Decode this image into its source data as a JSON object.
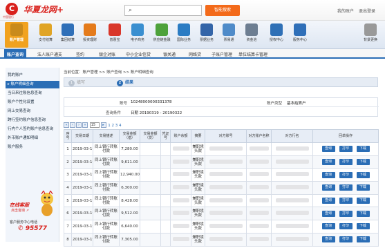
{
  "header": {
    "logo_mark": "C",
    "logo_sub": "中国银行",
    "logo_text": "华夏龙网+",
    "search_button": "智能搜索",
    "links": [
      "我的账户",
      "退出登录"
    ]
  },
  "nav": {
    "items": [
      {
        "label": "账户管理",
        "color": "#c98a1b",
        "active": true
      },
      {
        "label": "支付结算",
        "color": "#e0a425"
      },
      {
        "label": "集团结算",
        "color": "#2f6fb8"
      },
      {
        "label": "投资理财",
        "color": "#e47b1c"
      },
      {
        "label": "普惠宝",
        "color": "#d9372b"
      },
      {
        "label": "电子商务",
        "color": "#3a8fd0"
      },
      {
        "label": "供应链金融",
        "color": "#4ea23b"
      },
      {
        "label": "国际业务",
        "color": "#2b7cc3"
      },
      {
        "label": "票据业务",
        "color": "#3465a8"
      },
      {
        "label": "票易通",
        "color": "#4f8bc9"
      },
      {
        "label": "资金池",
        "color": "#6d7e92"
      },
      {
        "label": "授权中心",
        "color": "#2f70b6"
      },
      {
        "label": "服务中心",
        "color": "#2f6fb8"
      },
      {
        "label": "背景更换",
        "color": "#999999"
      }
    ]
  },
  "subnav": {
    "items": [
      "账户查询",
      "法人账户通支",
      "签约",
      "银企对账",
      "中小企业信贷",
      "银关通",
      "网络贷",
      "子账户管理",
      "单位结算卡管理"
    ]
  },
  "sidebar": {
    "items": [
      "我的账户",
      "账户明细查询",
      "当日来往账信息查询",
      "账户个性化设置",
      "网上交易查询",
      "跨行签约账户信息查询",
      "行内个人签约账户信息查询",
      "外币账户通知明细",
      "账户服务"
    ],
    "promo_title": "在线客服",
    "promo_sub": "点击咨询 ↗",
    "promo_hotline_label": "客户服务中心电话",
    "promo_hotline": "95577"
  },
  "breadcrumb": "当前位置：账户管理 >> 账户查询 >> 账户明细查询",
  "steps": [
    {
      "num": "1",
      "label": "填写"
    },
    {
      "num": "2",
      "label": "结果"
    }
  ],
  "info": {
    "account_label": "账号",
    "account_value": "10248000000331378",
    "account_type_label": "账户类型",
    "account_type_value": "基本结算户",
    "query_label": "查询条件",
    "query_value": "日期 20190319 - 20190322"
  },
  "pager": {
    "page_size": "15",
    "pages": "1 2 3 4"
  },
  "table": {
    "headers": [
      "序号",
      "交易日期",
      "交易描述",
      "交易金额（借）",
      "交易金额（贷）",
      "凭证号",
      "账户余额",
      "摘要",
      "对方账号",
      "对方账户名称",
      "对方行名",
      "回单操作"
    ],
    "actions": [
      "查询",
      "打印",
      "下载"
    ],
    "rows": [
      {
        "no": "1",
        "date": "2019-03-19",
        "desc": "同上银行转账付款",
        "debit": "7,280.00",
        "summary": "兼职境头款"
      },
      {
        "no": "2",
        "date": "2019-03-19",
        "desc": "同上银行转账付款",
        "debit": "9,611.00",
        "summary": "兼职境头款"
      },
      {
        "no": "3",
        "date": "2019-03-19",
        "desc": "同上银行转账付款",
        "debit": "12,940.00",
        "summary": "兼职境头款"
      },
      {
        "no": "4",
        "date": "2019-03-19",
        "desc": "同上银行转账付款",
        "debit": "6,300.00",
        "summary": "兼职境头款"
      },
      {
        "no": "5",
        "date": "2019-03-19",
        "desc": "同上银行转账付款",
        "debit": "8,428.00",
        "summary": "兼职境头款"
      },
      {
        "no": "6",
        "date": "2019-03-19",
        "desc": "同上银行转账付款",
        "debit": "9,512.00",
        "summary": "兼职境头款"
      },
      {
        "no": "7",
        "date": "2019-03-19",
        "desc": "同上银行转账付款",
        "debit": "6,640.00",
        "summary": "兼职境头款"
      },
      {
        "no": "8",
        "date": "2019-03-19",
        "desc": "同上银行转账付款",
        "debit": "7,305.00",
        "summary": "兼职境头款"
      }
    ]
  }
}
